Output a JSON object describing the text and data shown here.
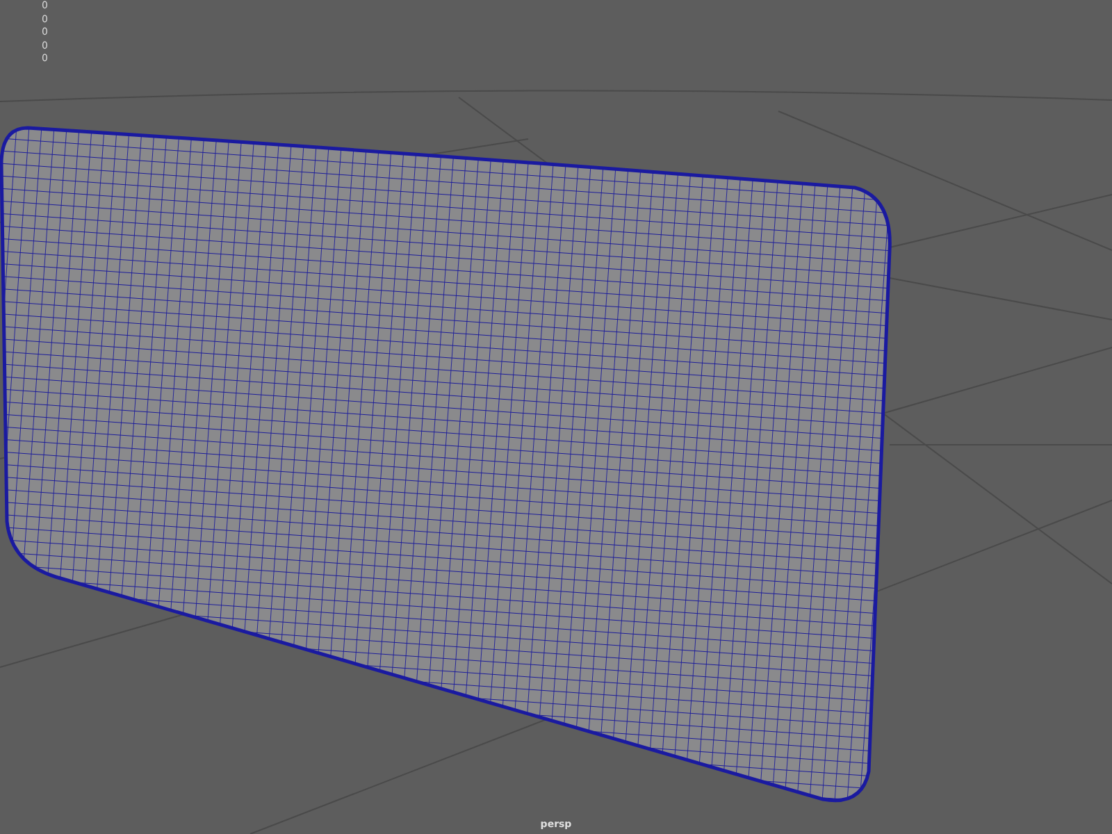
{
  "hud": {
    "values": [
      "0",
      "0",
      "0",
      "0",
      "0"
    ]
  },
  "viewport": {
    "camera_label": "persp"
  }
}
